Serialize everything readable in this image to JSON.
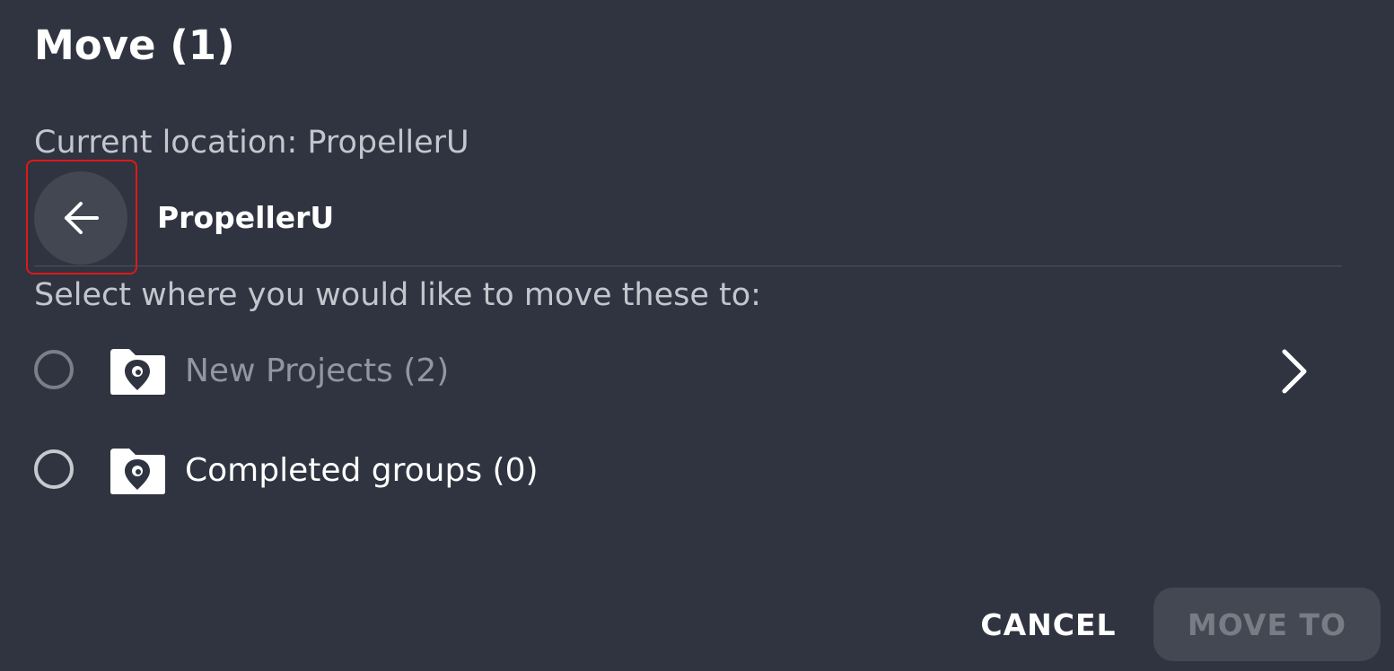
{
  "dialog": {
    "title": "Move (1)",
    "current_location": "Current location: PropellerU",
    "nav": {
      "back_icon": "arrow-left-icon",
      "label": "PropellerU"
    },
    "instruction": "Select where you would like to move these to:",
    "options": [
      {
        "label": "New Projects (2)",
        "icon": "folder-location-icon",
        "enabled": false,
        "has_children": true
      },
      {
        "label": "Completed groups (0)",
        "icon": "folder-location-icon",
        "enabled": true,
        "has_children": false
      }
    ],
    "buttons": {
      "cancel": "CANCEL",
      "move_to": "MOVE TO"
    }
  },
  "colors": {
    "background": "#2f3440",
    "highlight": "#e01818",
    "disabled_button": "#434852"
  }
}
